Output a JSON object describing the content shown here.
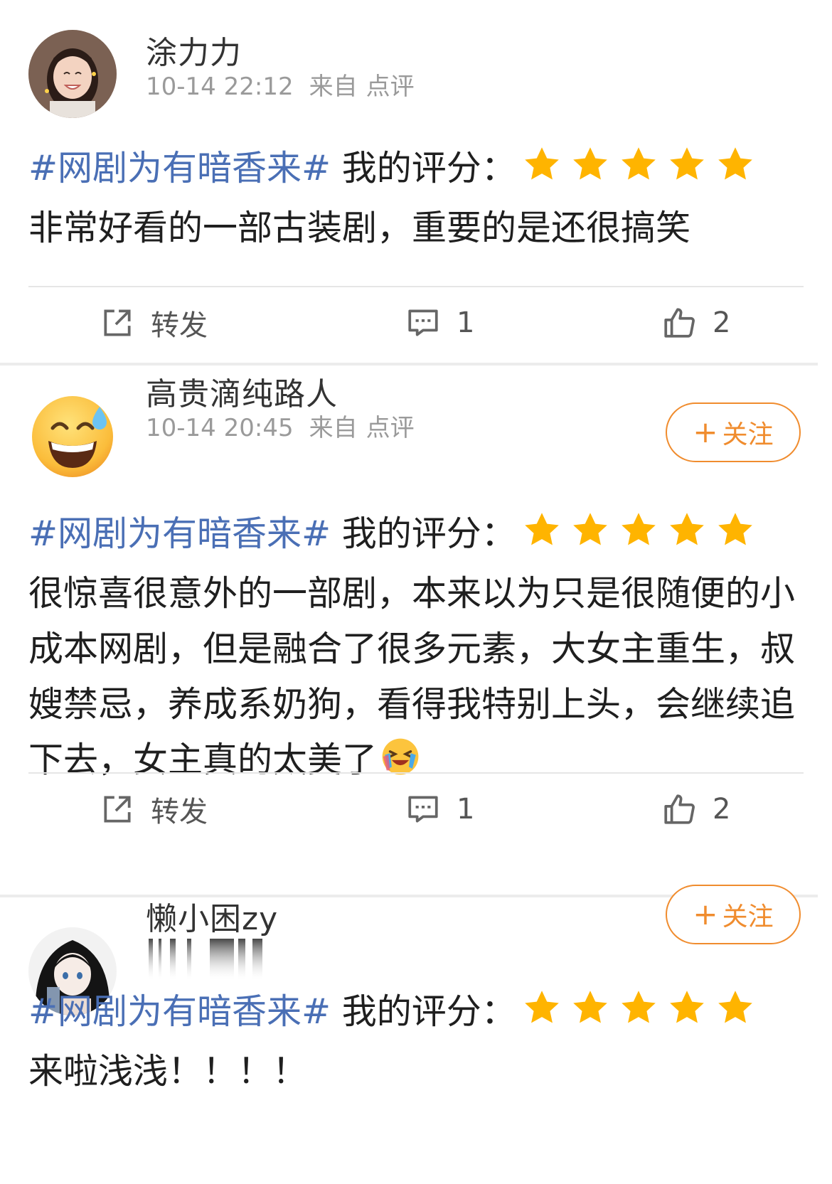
{
  "posts": [
    {
      "username": "涂力力",
      "time": "10-14 22:12",
      "source_prefix": "来自",
      "source": "点评",
      "follow_label": "",
      "hashtag": "#网剧为有暗香来#",
      "rating_label": " 我的评分：",
      "rating": 5,
      "text": "非常好看的一部古装剧，重要的是还很搞笑",
      "repost_label": "转发",
      "comment_count": "1",
      "like_count": "2"
    },
    {
      "username": "高贵滴纯路人",
      "time": "10-14 20:45",
      "source_prefix": "来自",
      "source": "点评",
      "follow_label": "关注",
      "hashtag": "#网剧为有暗香来#",
      "rating_label": " 我的评分：",
      "rating": 5,
      "text": "很惊喜很意外的一部剧，本来以为只是很随便的小成本网剧，但是融合了很多元素，大女主重生，叔嫂禁忌，养成系奶狗，看得我特别上头，会继续追下去，女主真的太美了",
      "repost_label": "转发",
      "comment_count": "1",
      "like_count": "2"
    },
    {
      "username": "懒小困zy",
      "time": "",
      "source_prefix": "",
      "source": "",
      "follow_label": "关注",
      "hashtag": "#网剧为有暗香来#",
      "rating_label": " 我的评分：",
      "rating": 5,
      "text": "来啦浅浅！！！！"
    }
  ],
  "colors": {
    "hashtag": "#4a6fb5",
    "star": "#ffb400",
    "follow": "#f08c2e",
    "meta": "#9a9a9a"
  },
  "icons": [
    "repost-icon",
    "comment-icon",
    "like-icon",
    "star-icon",
    "cry-laugh-emoji"
  ]
}
